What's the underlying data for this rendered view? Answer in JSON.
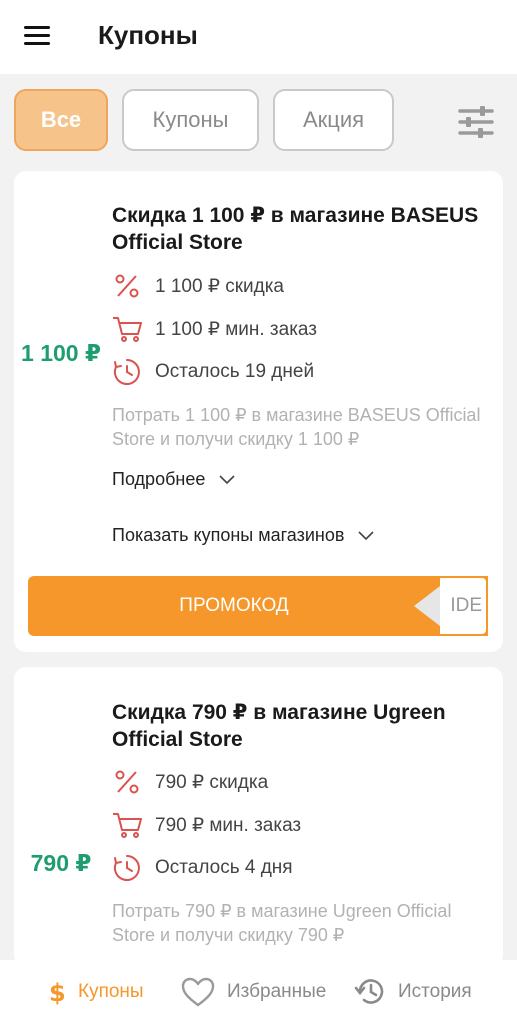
{
  "header": {
    "title": "Купоны"
  },
  "filters": {
    "all": "Все",
    "coupons": "Купоны",
    "promo": "Акция"
  },
  "cards": [
    {
      "amount": "1 100 ₽",
      "title": "Скидка 1 100 ₽ в магазине BASEUS Official Store",
      "discount": "1 100 ₽ скидка",
      "min_order": "1 100 ₽ мин. заказ",
      "remaining": "Осталось 19 дней",
      "description": "Потрать 1 100 ₽ в магазине BASEUS Official Store и получи скидку 1 100 ₽",
      "more": "Подробнее",
      "show_store_coupons": "Показать купоны магазинов",
      "promo_button": "ПРОМОКОД",
      "promo_peek": "IDE"
    },
    {
      "amount": "790 ₽",
      "title": "Скидка 790 ₽ в магазине Ugreen Official Store",
      "discount": "790 ₽ скидка",
      "min_order": "790 ₽ мин. заказ",
      "remaining": "Осталось 4 дня",
      "description": "Потрать 790 ₽ в магазине Ugreen Official Store и получи скидку 790 ₽"
    }
  ],
  "bottom_nav": {
    "coupons": "Купоны",
    "favorites": "Избранные",
    "history": "История"
  },
  "colors": {
    "accent": "#f5972a",
    "amount": "#1f9d6e",
    "icon": "#d9534f"
  }
}
